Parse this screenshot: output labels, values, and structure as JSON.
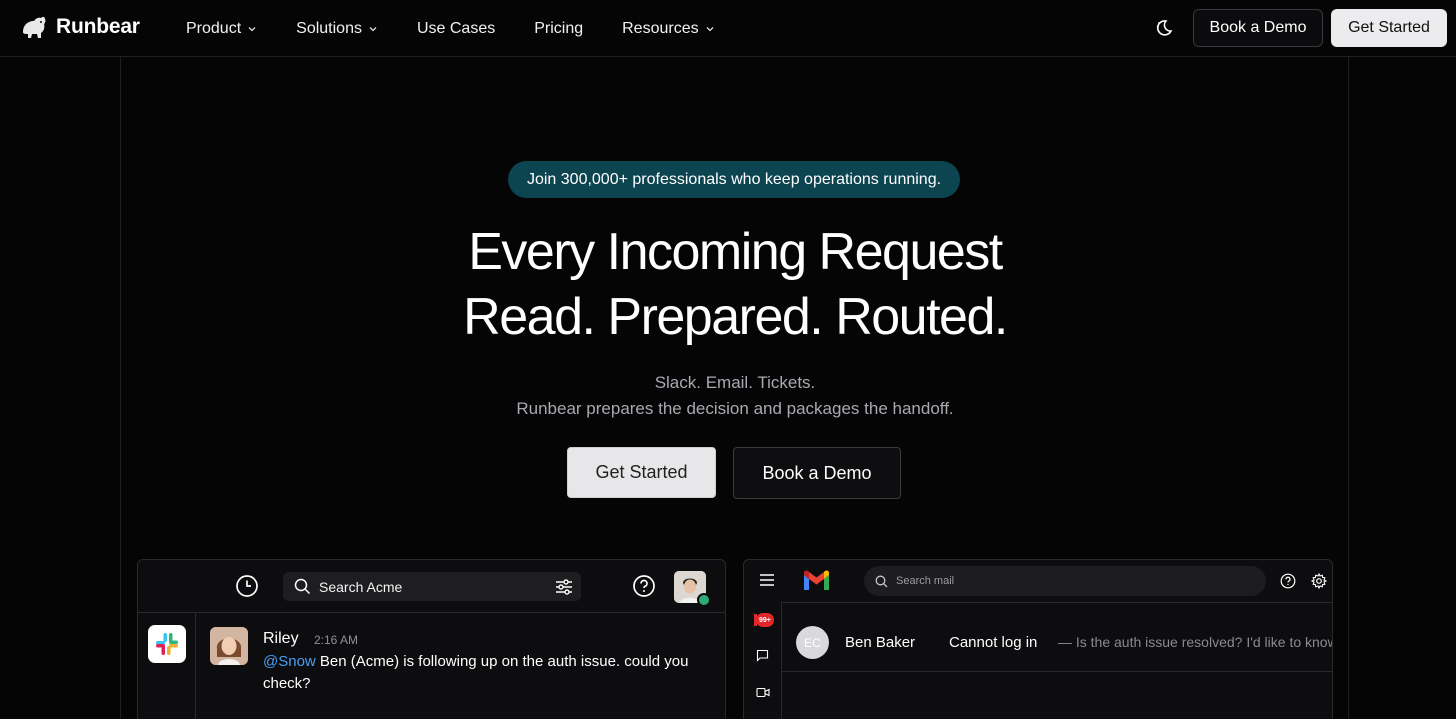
{
  "nav": {
    "brand": "Runbear",
    "links": [
      {
        "label": "Product",
        "dropdown": true
      },
      {
        "label": "Solutions",
        "dropdown": true
      },
      {
        "label": "Use Cases",
        "dropdown": false
      },
      {
        "label": "Pricing",
        "dropdown": false
      },
      {
        "label": "Resources",
        "dropdown": true
      }
    ],
    "book_demo": "Book a Demo",
    "get_started": "Get Started"
  },
  "hero": {
    "pill": "Join 300,000+ professionals who keep operations running.",
    "title_line1": "Every Incoming Request",
    "title_line2": "Read. Prepared. Routed.",
    "subtitle_line1": "Slack. Email. Tickets.",
    "subtitle_line2": "Runbear prepares the decision and packages the handoff.",
    "cta_primary": "Get Started",
    "cta_secondary": "Book a Demo"
  },
  "slack_card": {
    "search_placeholder": "Search Acme",
    "message": {
      "author": "Riley",
      "time": "2:16 AM",
      "mention": "@Snow",
      "text": " Ben (Acme) is following up on the auth issue. could you check?"
    }
  },
  "gmail_card": {
    "search_placeholder": "Search mail",
    "badge": "99+",
    "email": {
      "avatar_initials": "EC",
      "from": "Ben Baker",
      "subject": "Cannot log in",
      "snippet": "— Is the auth issue resolved? I'd like to know"
    }
  },
  "colors": {
    "background": "#050506",
    "pill": "#0c4450",
    "mention": "#4a9ff5",
    "online": "#2bac76",
    "badge": "#e2262a"
  }
}
